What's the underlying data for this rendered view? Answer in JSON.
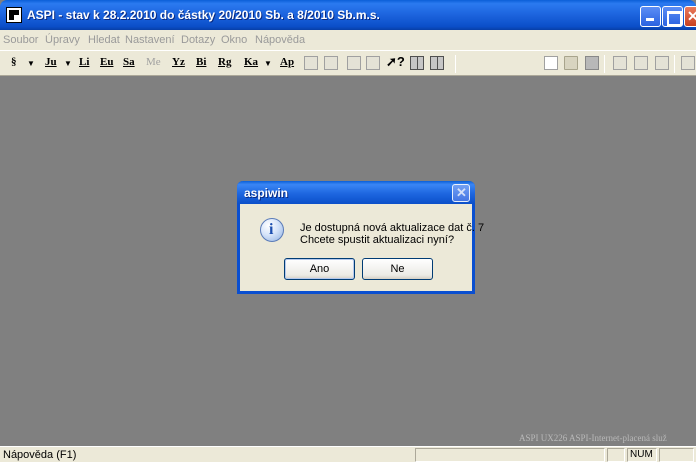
{
  "window": {
    "title": "ASPI  - stav k 28.2.2010 do částky 20/2010 Sb. a 8/2010 Sb.m.s."
  },
  "menu": [
    "Soubor",
    "Úpravy",
    "Hledat",
    "Nastavení",
    "Dotazy",
    "Okno",
    "Nápověda"
  ],
  "toolbar": {
    "buttons": [
      "§",
      "Ju",
      "Li",
      "Eu",
      "Sa",
      "Me",
      "Yz",
      "Bi",
      "Rg",
      "Ka",
      "Ap"
    ]
  },
  "dialog": {
    "title": "aspiwin",
    "message_line1": "Je dostupná nová aktualizace dat č. 7",
    "message_line2": "Chcete spustit aktualizaci nyní?",
    "yes_label": "Ano",
    "no_label": "Ne",
    "icon": "info-icon"
  },
  "status": {
    "help_text": "Nápověda (F1)",
    "num_indicator": "NUM"
  },
  "watermark": "ASPI UX226 ASPI-Internet-placená služ",
  "colors": {
    "titlebar": "#0b4fc9",
    "workspace": "#808080",
    "chrome": "#ece9d8"
  }
}
